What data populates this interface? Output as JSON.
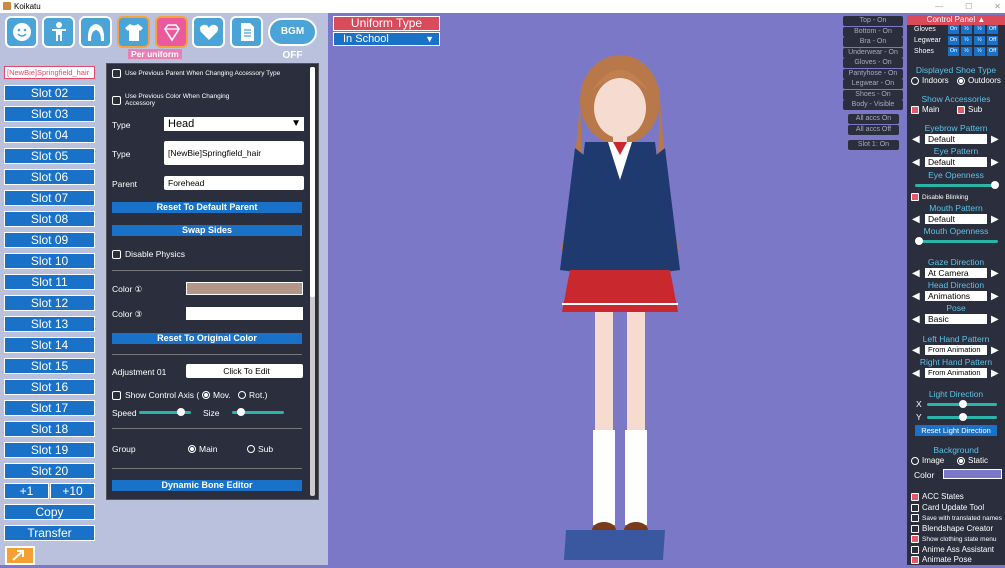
{
  "window": {
    "title": "Koikatu",
    "controls": [
      "—",
      "☐",
      "✕"
    ]
  },
  "toolbar": {
    "bgm_label": "BGM OFF",
    "per_uniform_label": "Per uniform"
  },
  "accessory": {
    "selected_label": "[NewBie]Springfield_hair",
    "slots": [
      "Slot 02",
      "Slot 03",
      "Slot 04",
      "Slot 05",
      "Slot 06",
      "Slot 07",
      "Slot 08",
      "Slot 09",
      "Slot 10",
      "Slot 11",
      "Slot 12",
      "Slot 13",
      "Slot 14",
      "Slot 15",
      "Slot 16",
      "Slot 17",
      "Slot 18",
      "Slot 19",
      "Slot 20"
    ],
    "add1": "+1",
    "add10": "+10",
    "copy": "Copy",
    "transfer": "Transfer"
  },
  "editor": {
    "use_prev_parent": "Use Previous Parent When Changing Accessory Type",
    "use_prev_color": "Use Previous Color When Changing Accessory",
    "type_label": "Type",
    "type_value": "Head",
    "type2_label": "Type",
    "type2_value": "[NewBie]Springfield_hair",
    "parent_label": "Parent",
    "parent_value": "Forehead",
    "reset_parent": "Reset To Default Parent",
    "swap_sides": "Swap Sides",
    "disable_physics": "Disable Physics",
    "color1_label": "Color ①",
    "color1": "#b49689",
    "color3_label": "Color ③",
    "color3": "#ffffff",
    "reset_color": "Reset To Original Color",
    "adjust_label": "Adjustment 01",
    "adjust_btn": "Click To Edit",
    "show_axis": "Show Control Axis (",
    "mov": "Mov.",
    "rot": "Rot.)",
    "speed": "Speed",
    "size": "Size",
    "group": "Group",
    "group_main": "Main",
    "group_sub": "Sub",
    "dyn_bone": "Dynamic Bone Editor"
  },
  "center": {
    "uniform_type": "Uniform Type",
    "uniform_value": "In School",
    "states": [
      "Top - On",
      "Bottom - On",
      "Bra - On",
      "Underwear - On",
      "Gloves - On",
      "Pantyhose - On",
      "Legwear - On",
      "Shoes - On",
      "Body - Visible"
    ],
    "accs_on": "All accs On",
    "accs_off": "All accs Off",
    "slot_on": "Slot 1: On"
  },
  "control": {
    "title": "Control Panel",
    "rows": [
      {
        "name": "Gloves",
        "cells": [
          "On",
          "½",
          "½",
          "Off"
        ]
      },
      {
        "name": "Legwear",
        "cells": [
          "On",
          "½",
          "½",
          "Off"
        ]
      },
      {
        "name": "Shoes",
        "cells": [
          "On",
          "½",
          "½",
          "Off"
        ]
      }
    ],
    "shoe_title": "Displayed Shoe Type",
    "indoors": "Indoors",
    "outdoors": "Outdoors",
    "show_acc": "Show Accessories",
    "main": "Main",
    "sub": "Sub",
    "eyebrow_title": "Eyebrow Pattern",
    "eyebrow": "Default",
    "eye_title": "Eye Pattern",
    "eye": "Default",
    "eye_open": "Eye Openness",
    "disable_blink": "Disable Blinking",
    "mouth_title": "Mouth Pattern",
    "mouth": "Default",
    "mouth_open": "Mouth Openness",
    "gaze_title": "Gaze Direction",
    "gaze": "At Camera",
    "head_title": "Head Direction",
    "head": "Animations",
    "pose_title": "Pose",
    "pose": "Basic",
    "lhand_title": "Left Hand Pattern",
    "lhand": "From Animation",
    "rhand_title": "Right Hand Pattern",
    "rhand": "From Animation",
    "light_title": "Light Direction",
    "x": "X",
    "y": "Y",
    "reset_light": "Reset Light Direction",
    "bg_title": "Background",
    "image": "Image",
    "static": "Static",
    "color": "Color",
    "acc_states": "ACC States",
    "card_update": "Card Update Tool",
    "save_trans": "Save with translated names",
    "blendshape": "Blendshape Creator",
    "show_cloth": "Show clothing state menu",
    "anime_ass": "Anime Ass Assistant",
    "animate_pose": "Animate Pose"
  },
  "colors": {
    "accent": "#1a72c8",
    "red": "#d94a5a",
    "panel": "#2b2e3d",
    "viewport": "#7b78c8"
  }
}
